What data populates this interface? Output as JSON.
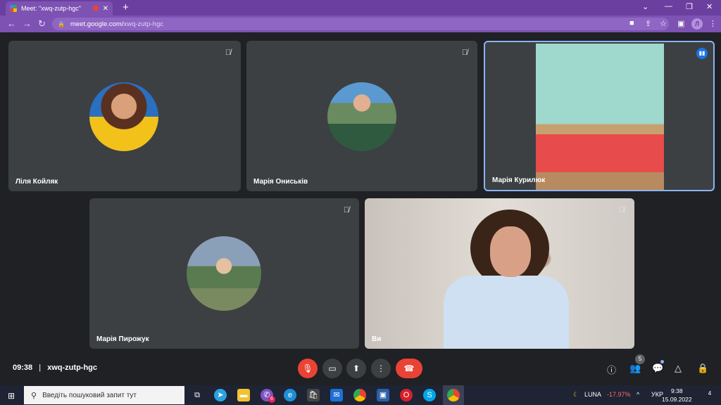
{
  "browser": {
    "tab_title": "Meet: \"xwq-zutp-hgc\"",
    "url_host": "meet.google.com/",
    "url_path": "xwq-zutp-hgc",
    "profile_initial": "Л"
  },
  "participants": [
    {
      "name": "Ліля Койляк"
    },
    {
      "name": "Марія Ониськів"
    },
    {
      "name": "Марія Курилюк"
    },
    {
      "name": "Марія Пирожук"
    },
    {
      "name": "Ви"
    }
  ],
  "meeting": {
    "time": "09:38",
    "separator": "|",
    "code": "xwq-zutp-hgc",
    "people_count": "5"
  },
  "taskbar": {
    "search_placeholder": "Введіть пошуковий запит тут",
    "ticker_name": "LUNA",
    "ticker_change": "-17.97%",
    "language": "УКР",
    "time": "9:38",
    "date": "15.09.2022",
    "notification_count": "4",
    "viber_badge": "6"
  },
  "colors": {
    "accent": "#1a73e8",
    "danger": "#ea4335",
    "tile": "#3c4043",
    "chrome": "#7d52b3"
  }
}
